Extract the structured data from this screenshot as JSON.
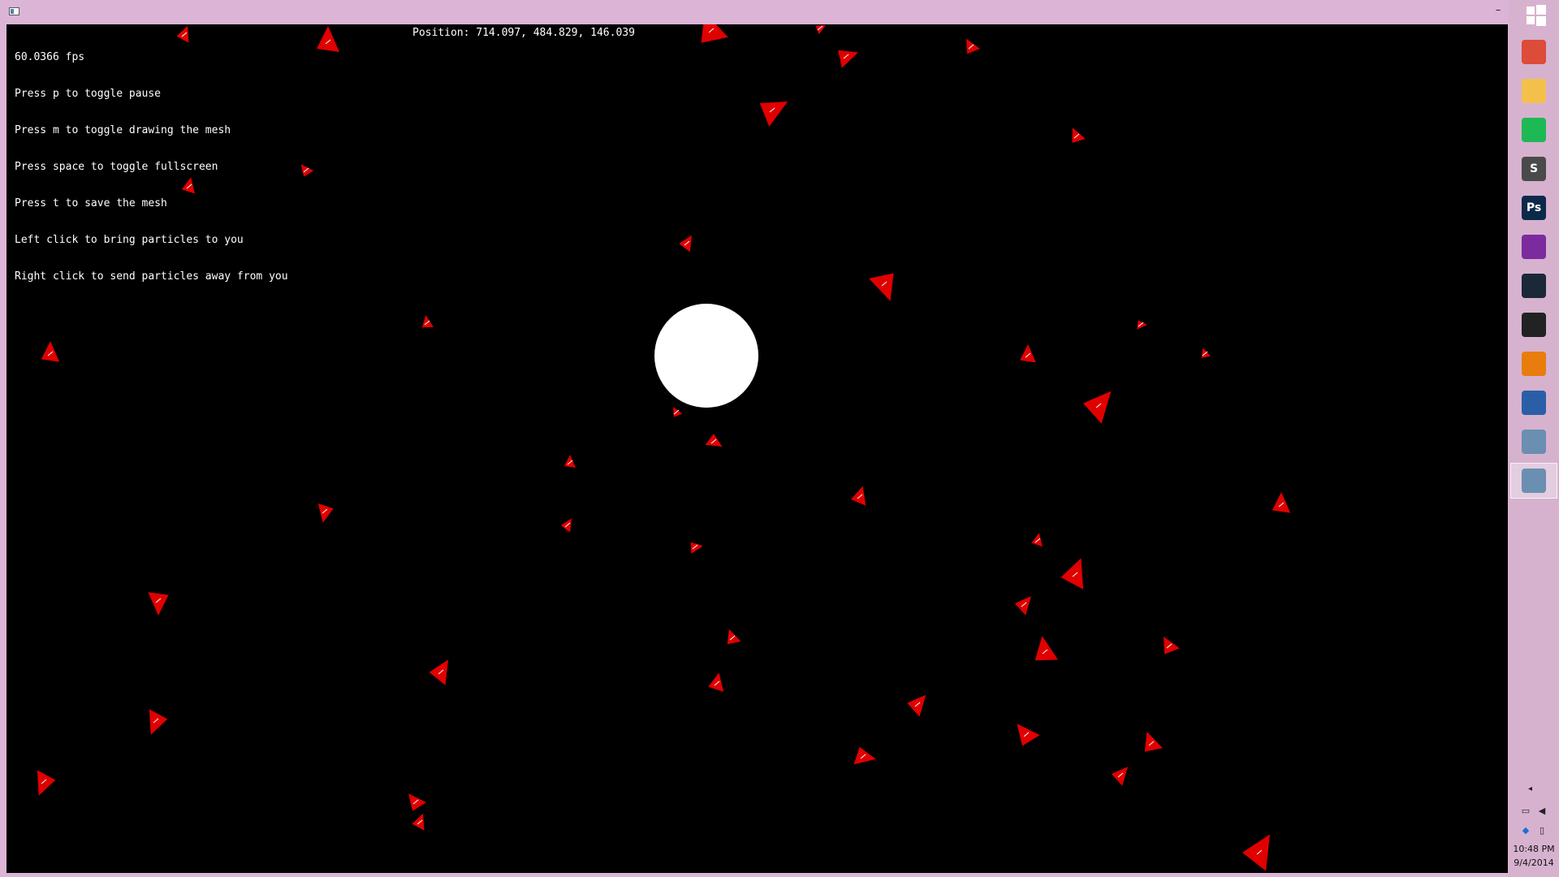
{
  "window": {
    "minimize_glyph": "–"
  },
  "hud": {
    "fps": "60.0366 fps",
    "position": "Position: 714.097, 484.829, 146.039",
    "instructions": [
      "Press p to toggle pause",
      "Press m to toggle drawing the mesh",
      "Press space to toggle fullscreen",
      "Press t to save the mesh",
      "Left click to bring particles to you",
      "Right click to send particles away from you"
    ]
  },
  "colors": {
    "particle": "#e00000",
    "sphere": "#ffffff",
    "background": "#000000",
    "taskbar": "#d6b2cf"
  },
  "taskbar": {
    "apps": [
      {
        "name": "chrome-icon",
        "label": "",
        "color": "#dd4b39"
      },
      {
        "name": "file-explorer-icon",
        "label": "",
        "color": "#f3c14b"
      },
      {
        "name": "spotify-icon",
        "label": "",
        "color": "#1db954"
      },
      {
        "name": "sublime-text-icon",
        "label": "S",
        "color": "#4a4a4a"
      },
      {
        "name": "photoshop-icon",
        "label": "Ps",
        "color": "#0b2a4a"
      },
      {
        "name": "windows-tiles-icon",
        "label": "",
        "color": "#7b2b9e"
      },
      {
        "name": "steam-icon",
        "label": "",
        "color": "#1b2838"
      },
      {
        "name": "unity-icon",
        "label": "",
        "color": "#222222"
      },
      {
        "name": "blender-icon",
        "label": "",
        "color": "#e87d0d"
      },
      {
        "name": "powershell-icon",
        "label": "",
        "color": "#2a5fa8"
      },
      {
        "name": "app-window-icon",
        "label": "",
        "color": "#6a8fb0"
      },
      {
        "name": "app-window-icon",
        "label": "",
        "color": "#6a8fb0"
      }
    ],
    "clock_time": "10:48 PM",
    "clock_date": "9/4/2014"
  }
}
